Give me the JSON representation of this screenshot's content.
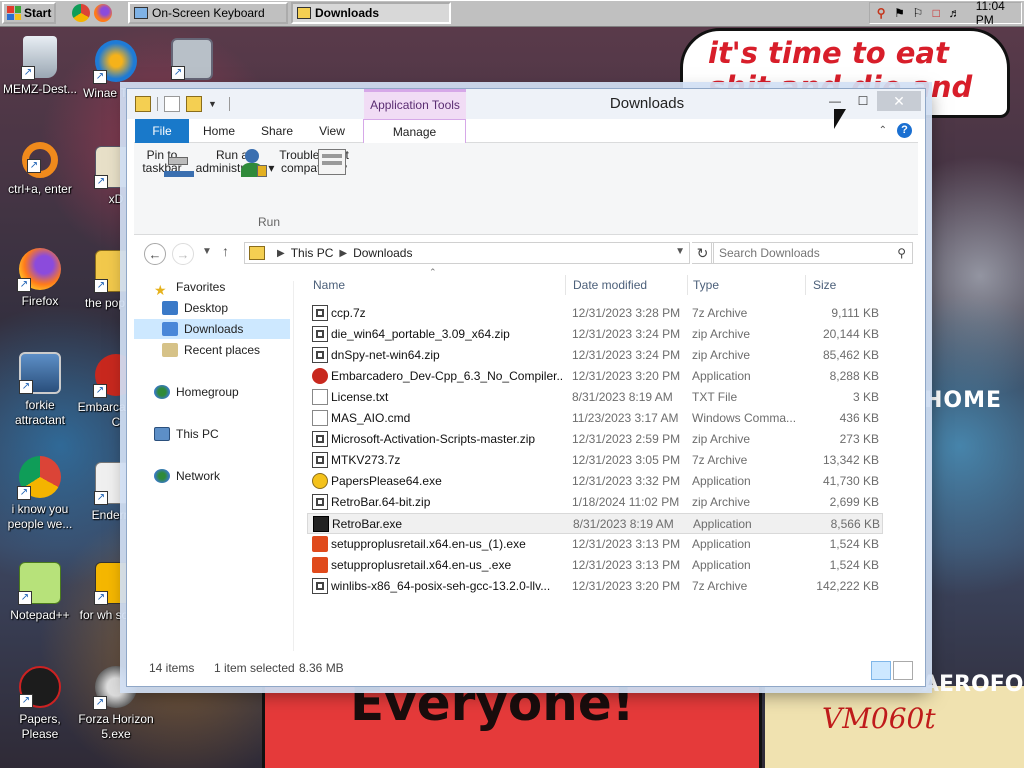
{
  "taskbar": {
    "start_label": "Start",
    "tasks": [
      {
        "label": "On-Screen Keyboard",
        "active": false
      },
      {
        "label": "Downloads",
        "active": true
      }
    ],
    "clock": "11:04 PM"
  },
  "desktop": {
    "wallpaper_text": {
      "bubble": "it's time to eat shit and die and celebrate",
      "everyone": "Everyone!",
      "vm": "VM060t",
      "home": "HOME",
      "aero": "AEROFOS"
    },
    "icons": [
      {
        "label": "MEMZ-Dest...",
        "icon": "recycle-bin-icon"
      },
      {
        "label": "Winae Twea",
        "icon": "winaero-icon"
      },
      {
        "label": "",
        "icon": "windows-icon"
      },
      {
        "label": "ctrl+a, enter",
        "icon": "orange-ring-icon"
      },
      {
        "label": "xD",
        "icon": "hx-icon"
      },
      {
        "label": "Firefox",
        "icon": "firefox-icon"
      },
      {
        "label": "the pop shit",
        "icon": "folder-icon"
      },
      {
        "label": "forkie attractant",
        "icon": "computer-icon"
      },
      {
        "label": "Embarca Dev-C",
        "icon": "devcpp-icon"
      },
      {
        "label": "i know you people we...",
        "icon": "chrome-icon"
      },
      {
        "label": "Enderma",
        "icon": "app-icon"
      },
      {
        "label": "Notepad++",
        "icon": "notepad-icon"
      },
      {
        "label": "for wh some r",
        "icon": "document-icon"
      },
      {
        "label": "Papers, Please",
        "icon": "papers-please-icon"
      },
      {
        "label": "Forza Horizon 5.exe",
        "icon": "flash-icon"
      }
    ]
  },
  "window": {
    "title": "Downloads",
    "app_tools_label": "Application Tools",
    "tabs": [
      "File",
      "Home",
      "Share",
      "View",
      "Manage"
    ],
    "ribbon": {
      "buttons": [
        {
          "label_line1": "Pin to",
          "label_line2": "taskbar"
        },
        {
          "label_line1": "Run as",
          "label_line2": "administrator ▾"
        },
        {
          "label_line1": "Troubleshoot",
          "label_line2": "compatibility"
        }
      ],
      "group_label": "Run"
    },
    "address": {
      "crumbs": [
        "This PC",
        "Downloads"
      ],
      "search_placeholder": "Search Downloads"
    },
    "nav": {
      "favorites": "Favorites",
      "desktop": "Desktop",
      "downloads": "Downloads",
      "recent": "Recent places",
      "homegroup": "Homegroup",
      "thispc": "This PC",
      "network": "Network"
    },
    "columns": [
      "Name",
      "Date modified",
      "Type",
      "Size"
    ],
    "files": [
      {
        "name": "ccp.7z",
        "date": "12/31/2023 3:28 PM",
        "type": "7z Archive",
        "size": "9,111 KB",
        "icon": "archive"
      },
      {
        "name": "die_win64_portable_3.09_x64.zip",
        "date": "12/31/2023 3:24 PM",
        "type": "zip Archive",
        "size": "20,144 KB",
        "icon": "archive"
      },
      {
        "name": "dnSpy-net-win64.zip",
        "date": "12/31/2023 3:24 PM",
        "type": "zip Archive",
        "size": "85,462 KB",
        "icon": "archive"
      },
      {
        "name": "Embarcadero_Dev-Cpp_6.3_No_Compiler...",
        "date": "12/31/2023 3:20 PM",
        "type": "Application",
        "size": "8,288 KB",
        "icon": "devcpp"
      },
      {
        "name": "License.txt",
        "date": "8/31/2023 8:19 AM",
        "type": "TXT File",
        "size": "3 KB",
        "icon": "text"
      },
      {
        "name": "MAS_AIO.cmd",
        "date": "11/23/2023 3:17 AM",
        "type": "Windows Comma...",
        "size": "436 KB",
        "icon": "text"
      },
      {
        "name": "Microsoft-Activation-Scripts-master.zip",
        "date": "12/31/2023 2:59 PM",
        "type": "zip Archive",
        "size": "273 KB",
        "icon": "archive"
      },
      {
        "name": "MTKV273.7z",
        "date": "12/31/2023 3:05 PM",
        "type": "7z Archive",
        "size": "13,342 KB",
        "icon": "archive"
      },
      {
        "name": "PapersPlease64.exe",
        "date": "12/31/2023 3:32 PM",
        "type": "Application",
        "size": "41,730 KB",
        "icon": "papers"
      },
      {
        "name": "RetroBar.64-bit.zip",
        "date": "1/18/2024 11:02 PM",
        "type": "zip Archive",
        "size": "2,699 KB",
        "icon": "archive"
      },
      {
        "name": "RetroBar.exe",
        "date": "8/31/2023 8:19 AM",
        "type": "Application",
        "size": "8,566 KB",
        "icon": "retrobar",
        "selected": true
      },
      {
        "name": "setupproplusretail.x64.en-us_(1).exe",
        "date": "12/31/2023 3:13 PM",
        "type": "Application",
        "size": "1,524 KB",
        "icon": "office"
      },
      {
        "name": "setupproplusretail.x64.en-us_.exe",
        "date": "12/31/2023 3:13 PM",
        "type": "Application",
        "size": "1,524 KB",
        "icon": "office"
      },
      {
        "name": "winlibs-x86_64-posix-seh-gcc-13.2.0-llv...",
        "date": "12/31/2023 3:20 PM",
        "type": "7z Archive",
        "size": "142,222 KB",
        "icon": "archive"
      }
    ],
    "status": {
      "items": "14 items",
      "selected": "1 item selected",
      "size": "8.36 MB"
    }
  }
}
